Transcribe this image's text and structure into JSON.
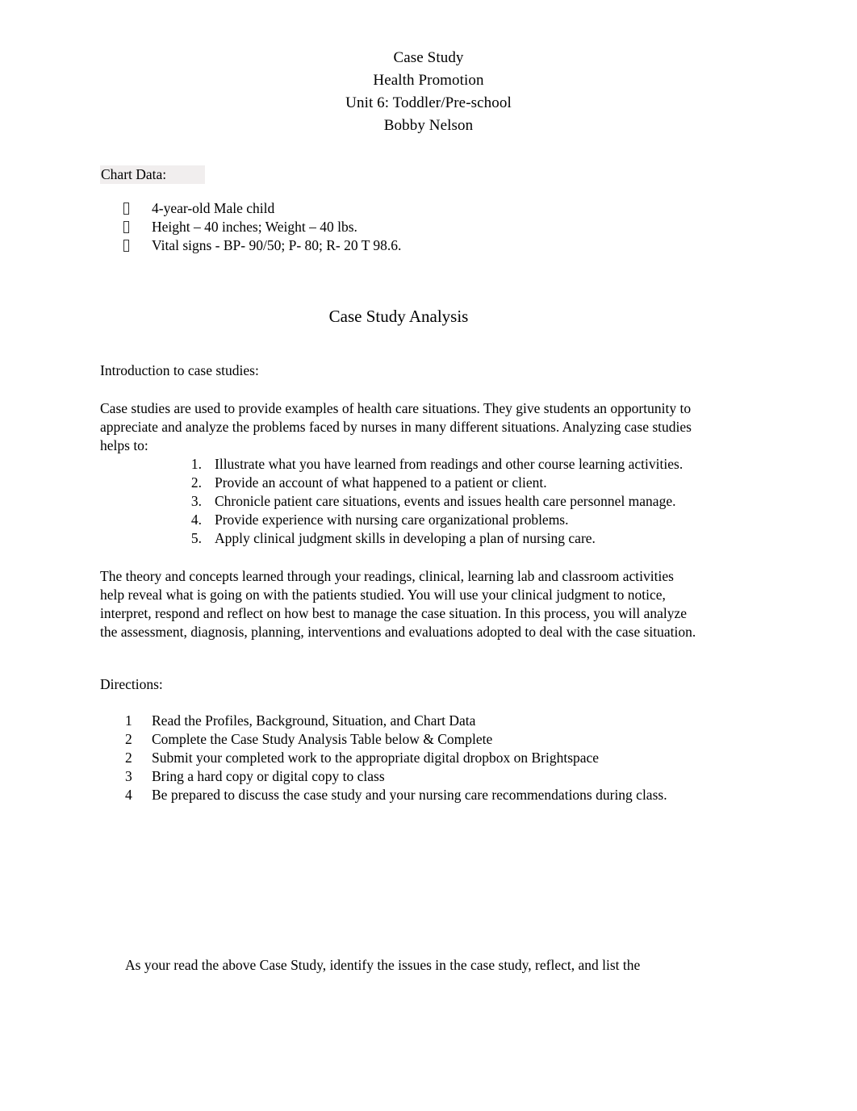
{
  "document": {
    "title_lines": [
      "Case Study",
      "Health Promotion",
      "Unit 6: Toddler/Pre-school",
      "Bobby Nelson"
    ],
    "chart_data_section": {
      "heading": "Chart Data:",
      "highlight_color": "#f1eeee",
      "bullet_glyph": "missing-glyph-box",
      "items": [
        "4-year-old Male child",
        "Height – 40 inches; Weight – 40 lbs.",
        "Vital signs - BP- 90/50; P- 80; R- 20 T 98.6."
      ]
    },
    "analysis_heading": "Case Study Analysis",
    "intro": {
      "heading": "Introduction to case studies:",
      "paragraph": "Case studies are used to provide examples of health care situations. They give students an opportunity to appreciate and analyze the problems faced by nurses in many different situations. Analyzing case studies helps to:",
      "numbered_items": [
        {
          "marker": "1.",
          "text": "Illustrate what you have learned from readings and other course learning activities."
        },
        {
          "marker": "2.",
          "text": "Provide an account of what happened to a patient or client."
        },
        {
          "marker": "3.",
          "text": "Chronicle patient care situations, events and issues health care personnel manage."
        },
        {
          "marker": "4.",
          "text": "Provide experience with nursing care organizational problems."
        },
        {
          "marker": "5.",
          "text": "Apply clinical judgment skills in developing a plan of nursing care."
        }
      ]
    },
    "theory_paragraph": "The theory and concepts learned through your readings, clinical, learning lab and classroom activities help reveal what is going on with the patients studied. You will use your clinical judgment to notice, interpret, respond and reflect on how best to manage the case situation. In this process, you will analyze the assessment, diagnosis, planning, interventions and evaluations adopted to deal with the case situation.",
    "directions": {
      "heading": "Directions:",
      "items": [
        {
          "marker": "1",
          "text": "Read the Profiles, Background, Situation, and Chart Data"
        },
        {
          "marker": "2",
          "text": "Complete the Case Study Analysis Table below & Complete"
        },
        {
          "marker": "2",
          "text": "Submit your completed work to the appropriate digital dropbox on Brightspace"
        },
        {
          "marker": "3",
          "text": "Bring a hard copy or digital copy to class"
        },
        {
          "marker": "4",
          "text": "Be prepared to discuss the case study and your nursing care recommendations during class."
        }
      ]
    },
    "closing_line": "As your read the above Case Study, identify the issues in the case study, reflect, and list the"
  }
}
